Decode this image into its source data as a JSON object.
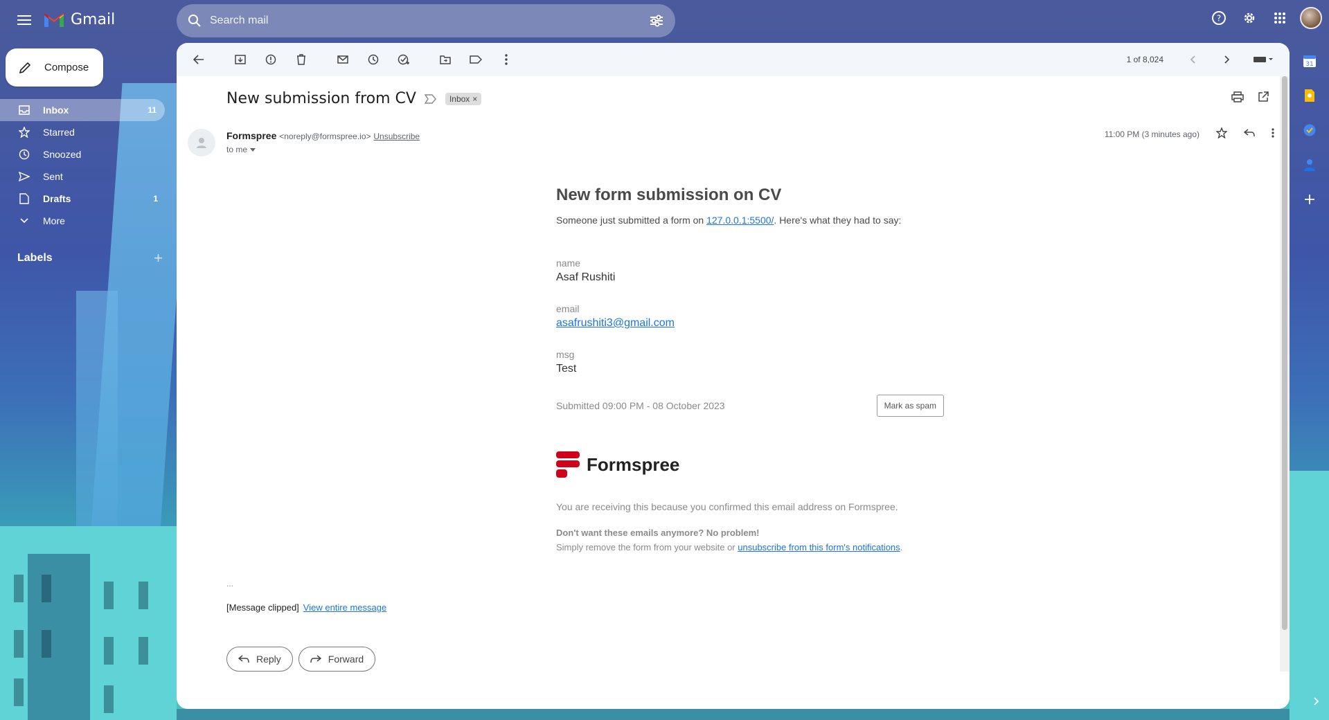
{
  "app": {
    "name": "Gmail"
  },
  "search": {
    "placeholder": "Search mail"
  },
  "compose": {
    "label": "Compose"
  },
  "nav": {
    "items": [
      {
        "label": "Inbox",
        "count": "11"
      },
      {
        "label": "Starred",
        "count": ""
      },
      {
        "label": "Snoozed",
        "count": ""
      },
      {
        "label": "Sent",
        "count": ""
      },
      {
        "label": "Drafts",
        "count": "1"
      },
      {
        "label": "More",
        "count": ""
      }
    ],
    "labels_header": "Labels"
  },
  "toolbar": {
    "pagination": "1 of 8,024"
  },
  "email": {
    "subject": "New submission from CV",
    "chip": "Inbox",
    "sender_name": "Formspree",
    "sender_email": "<noreply@formspree.io>",
    "unsubscribe": "Unsubscribe",
    "to": "to me",
    "time": "11:00 PM (3 minutes ago)",
    "body": {
      "heading": "New form submission on CV",
      "intro_before": "Someone just submitted a form on ",
      "intro_link": "127.0.0.1:5500/",
      "intro_after": ". Here's what they had to say:",
      "fields": [
        {
          "label": "name",
          "value": "Asaf Rushiti"
        },
        {
          "label": "email",
          "value": "asafrushiti3@gmail.com"
        },
        {
          "label": "msg",
          "value": "Test"
        }
      ],
      "submitted": "Submitted 09:00 PM - 08 October 2023",
      "spam_button": "Mark as spam",
      "brand": "Formspree",
      "footer_1": "You are receiving this because you confirmed this email address on Formspree.",
      "footer_2": "Don't want these emails anymore? No problem!",
      "footer_3_before": "Simply remove the form from your website or ",
      "footer_3_link": "unsubscribe from this form's notifications",
      "footer_3_after": "."
    },
    "ellipsis": "...",
    "clipped": "[Message clipped]",
    "view_entire": "View entire message",
    "reply": "Reply",
    "forward": "Forward"
  },
  "colors": {
    "accent": "#1a73e8",
    "brand_red": "#d0021b"
  }
}
